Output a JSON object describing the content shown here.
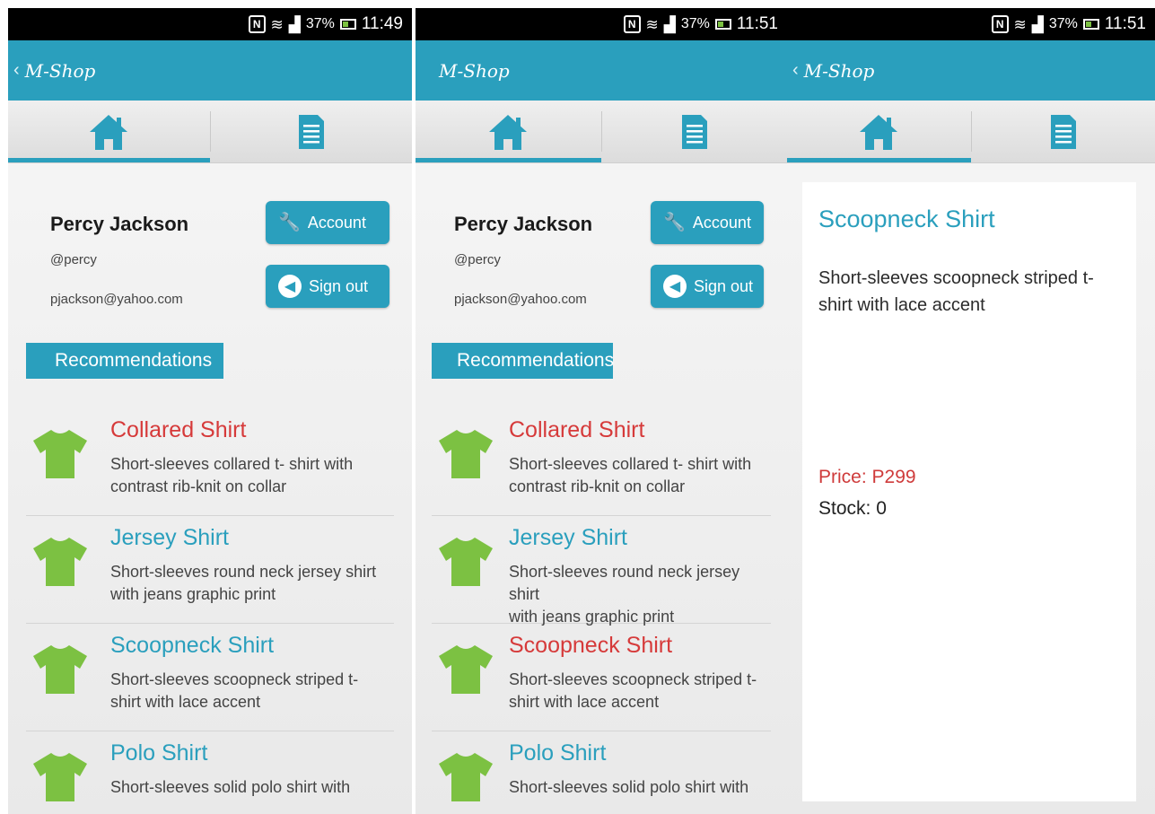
{
  "screens": [
    {
      "status": {
        "battery": "37%",
        "time": "11:49"
      },
      "app_title": "M-Shop",
      "profile": {
        "name": "Percy Jackson",
        "handle": "@percy",
        "email": "pjackson@yahoo.com"
      },
      "buttons": {
        "account": "Account",
        "signout": "Sign out"
      },
      "section_title": "Recommendations",
      "items": [
        {
          "title": "Collared Shirt",
          "desc_line1": "Short-sleeves collared t- shirt with",
          "desc_line2": "contrast rib-knit on collar",
          "title_color": "#d63a3a"
        },
        {
          "title": "Jersey Shirt",
          "desc_line1": "Short-sleeves round neck jersey shirt",
          "desc_line2": "with jeans graphic print",
          "title_color": "#2a9fbd"
        },
        {
          "title": "Scoopneck Shirt",
          "desc_line1": "Short-sleeves scoopneck striped t-",
          "desc_line2": "shirt with lace accent",
          "title_color": "#2a9fbd"
        },
        {
          "title": "Polo Shirt",
          "desc_line1": "Short-sleeves solid polo shirt with",
          "desc_line2": "",
          "title_color": "#2a9fbd"
        }
      ]
    },
    {
      "status": {
        "battery": "37%",
        "time": "11:51"
      },
      "app_title": "M-Shop",
      "profile": {
        "name": "Percy Jackson",
        "handle": "@percy",
        "email": "pjackson@yahoo.com"
      },
      "buttons": {
        "account": "Account",
        "signout": "Sign out"
      },
      "section_title": "Recommendations",
      "items": [
        {
          "title": "Collared Shirt",
          "desc_line1": "Short-sleeves collared t- shirt with",
          "desc_line2": "contrast rib-knit on collar",
          "title_color": "#d63a3a"
        },
        {
          "title": "Jersey Shirt",
          "desc_line1": "Short-sleeves round neck jersey shirt",
          "desc_line2": "with jeans graphic print",
          "title_color": "#2a9fbd"
        },
        {
          "title": "Scoopneck Shirt",
          "desc_line1": "Short-sleeves scoopneck striped t-",
          "desc_line2": "shirt with lace accent",
          "title_color": "#d63a3a"
        },
        {
          "title": "Polo Shirt",
          "desc_line1": "Short-sleeves solid polo shirt with",
          "desc_line2": "",
          "title_color": "#2a9fbd"
        }
      ]
    },
    {
      "status": {
        "battery": "37%",
        "time": "11:51"
      },
      "app_title": "M-Shop",
      "detail": {
        "title": "Scoopneck Shirt",
        "desc_line1": "Short-sleeves scoopneck striped t-",
        "desc_line2": "shirt with lace accent",
        "price": "Price: P299",
        "stock": "Stock: 0"
      }
    }
  ],
  "colors": {
    "accent": "#2a9fbd",
    "highlight": "#d63a3a",
    "shirt": "#7cc142"
  },
  "icons": {
    "home_tab": "home-icon",
    "list_tab": "document-icon",
    "account_button": "wrench-icon",
    "signout_button": "arrow-left-circle-icon"
  }
}
